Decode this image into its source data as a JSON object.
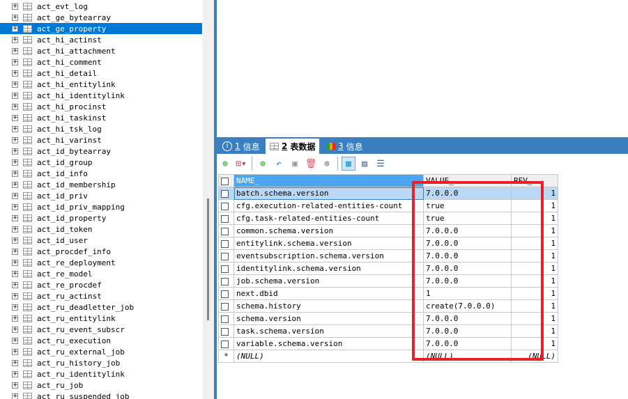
{
  "tree": {
    "selected": "act_ge_property",
    "items": [
      "act_evt_log",
      "act_ge_bytearray",
      "act_ge_property",
      "act_hi_actinst",
      "act_hi_attachment",
      "act_hi_comment",
      "act_hi_detail",
      "act_hi_entitylink",
      "act_hi_identitylink",
      "act_hi_procinst",
      "act_hi_taskinst",
      "act_hi_tsk_log",
      "act_hi_varinst",
      "act_id_bytearray",
      "act_id_group",
      "act_id_info",
      "act_id_membership",
      "act_id_priv",
      "act_id_priv_mapping",
      "act_id_property",
      "act_id_token",
      "act_id_user",
      "act_procdef_info",
      "act_re_deployment",
      "act_re_model",
      "act_re_procdef",
      "act_ru_actinst",
      "act_ru_deadletter_job",
      "act_ru_entitylink",
      "act_ru_event_subscr",
      "act_ru_execution",
      "act_ru_external_job",
      "act_ru_history_job",
      "act_ru_identitylink",
      "act_ru_job",
      "act_ru_suspended_job"
    ]
  },
  "tabs": [
    {
      "num": "1",
      "label": "信息",
      "icon": "info-icon"
    },
    {
      "num": "2",
      "label": "表数据",
      "icon": "table-icon",
      "active": true
    },
    {
      "num": "3",
      "label": "信息",
      "icon": "shapes-icon"
    }
  ],
  "grid": {
    "columns": [
      "NAME_",
      "VALUE_",
      "REV_"
    ],
    "rows": [
      [
        "batch.schema.version",
        "7.0.0.0",
        "1"
      ],
      [
        "cfg.execution-related-entities-count",
        "true",
        "1"
      ],
      [
        "cfg.task-related-entities-count",
        "true",
        "1"
      ],
      [
        "common.schema.version",
        "7.0.0.0",
        "1"
      ],
      [
        "entitylink.schema.version",
        "7.0.0.0",
        "1"
      ],
      [
        "eventsubscription.schema.version",
        "7.0.0.0",
        "1"
      ],
      [
        "identitylink.schema.version",
        "7.0.0.0",
        "1"
      ],
      [
        "job.schema.version",
        "7.0.0.0",
        "1"
      ],
      [
        "next.dbid",
        "1",
        "1"
      ],
      [
        "schema.history",
        "create(7.0.0.0)",
        "1"
      ],
      [
        "schema.version",
        "7.0.0.0",
        "1"
      ],
      [
        "task.schema.version",
        "7.0.0.0",
        "1"
      ],
      [
        "variable.schema.version",
        "7.0.0.0",
        "1"
      ]
    ],
    "new_row": {
      "marker": "*",
      "null": "(NULL)"
    }
  },
  "colors": {
    "accent": "#3c7fc1",
    "selection": "#0078d7",
    "highlight": "#e8202a"
  }
}
